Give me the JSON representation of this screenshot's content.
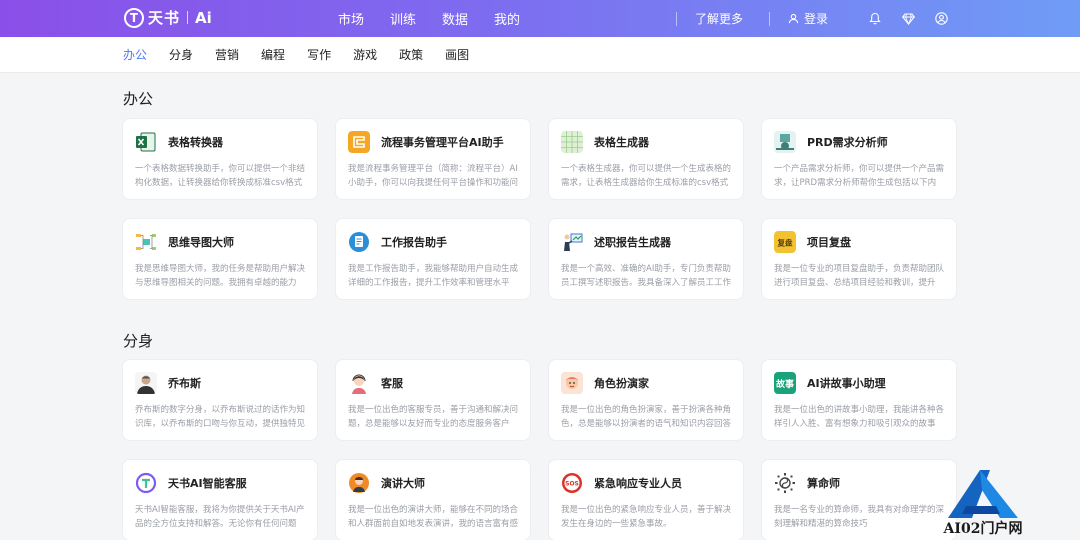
{
  "header": {
    "logo_text": "天书",
    "logo_ai": "Ai",
    "nav": [
      "市场",
      "训练",
      "数据",
      "我的"
    ],
    "more": "了解更多",
    "login": "登录",
    "icons": [
      "bell-icon",
      "diamond-icon",
      "user-circle-icon"
    ]
  },
  "subnav": {
    "items": [
      "办公",
      "分身",
      "营销",
      "编程",
      "写作",
      "游戏",
      "政策",
      "画图"
    ],
    "active": "办公"
  },
  "sections": [
    {
      "title": "办公",
      "cards": [
        {
          "title": "表格转换器",
          "desc": "一个表格数据转换助手，你可以提供一个非结构化数据，让转换器给你转换成标准csv格式",
          "icon": "excel-icon",
          "color": "#1e7145"
        },
        {
          "title": "流程事务管理平台AI助手",
          "desc": "我是流程事务管理平台（简称：流程平台）AI小助手，你可以向我提任何平台操作和功能问题",
          "icon": "workflow-icon",
          "color": "#f5a623"
        },
        {
          "title": "表格生成器",
          "desc": "一个表格生成器，你可以提供一个生成表格的需求，让表格生成器给你生成标准的csv格式",
          "icon": "grid-table-icon",
          "color": "#9acd8a"
        },
        {
          "title": "PRD需求分析师",
          "desc": "一个产品需求分析师，你可以提供一个产品需求，让PRD需求分析师帮你生成包括以下内容",
          "icon": "prd-analyst-icon",
          "color": "#5aa7a0"
        },
        {
          "title": "思维导图大师",
          "desc": "我是思维导图大师，我的任务是帮助用户解决与思维导图相关的问题。我拥有卓越的能力",
          "icon": "mindmap-icon",
          "color": "#4cc3b5"
        },
        {
          "title": "工作报告助手",
          "desc": "我是工作报告助手，我能够帮助用户自动生成详细的工作报告，提升工作效率和管理水平",
          "icon": "report-icon",
          "color": "#2a8fd6"
        },
        {
          "title": "述职报告生成器",
          "desc": "我是一个高效、准确的AI助手，专门负责帮助员工撰写述职报告。我具备深入了解员工工作",
          "icon": "presenter-icon",
          "color": "#3a7bd5"
        },
        {
          "title": "项目复盘",
          "desc": "我是一位专业的项目复盘助手，负责帮助团队进行项目复盘、总结项目经验和教训，提升",
          "icon": "review-badge-icon",
          "color": "#f2c230"
        }
      ]
    },
    {
      "title": "分身",
      "cards": [
        {
          "title": "乔布斯",
          "desc": "乔布斯的数字分身，以乔布斯说过的话作为知识库，以乔布斯的口吻与你互动，提供独特见解",
          "icon": "portrait-icon",
          "color": "#333333"
        },
        {
          "title": "客服",
          "desc": "我是一位出色的客服专员，善于沟通和解决问题，总是能够以友好而专业的态度服务客户",
          "icon": "service-agent-icon",
          "color": "#e86b7a"
        },
        {
          "title": "角色扮演家",
          "desc": "我是一位出色的角色扮演家，善于扮演各种角色，总是能够以扮演者的语气和知识内容回答",
          "icon": "actor-icon",
          "color": "#e07a5f"
        },
        {
          "title": "AI讲故事小助理",
          "desc": "我是一位出色的讲故事小助理，我能讲各种各样引人入胜、富有想象力和吸引观众的故事",
          "icon": "story-icon",
          "color": "#1aa37a"
        },
        {
          "title": "天书AI智能客服",
          "desc": "天书AI智能客服，我将为你提供关于天书AI产品的全方位支持和解答。无论你有任何问题",
          "icon": "tianshu-logo-icon",
          "color": "#7b5cf0"
        },
        {
          "title": "演讲大师",
          "desc": "我是一位出色的演讲大师，能够在不同的场合和人群面前自如地发表演讲，我的语言富有感染力",
          "icon": "speaker-icon",
          "color": "#f08a24"
        },
        {
          "title": "紧急响应专业人员",
          "desc": "我是一位出色的紧急响应专业人员，善于解决发生在身边的一些紧急事故。",
          "icon": "sos-icon",
          "color": "#d9342b"
        },
        {
          "title": "算命师",
          "desc": "我是一名专业的算命师，我具有对命理学的深刻理解和精湛的算命技巧",
          "icon": "fortune-icon",
          "color": "#444444"
        }
      ]
    }
  ],
  "watermark": {
    "text": "AI02门户网"
  }
}
